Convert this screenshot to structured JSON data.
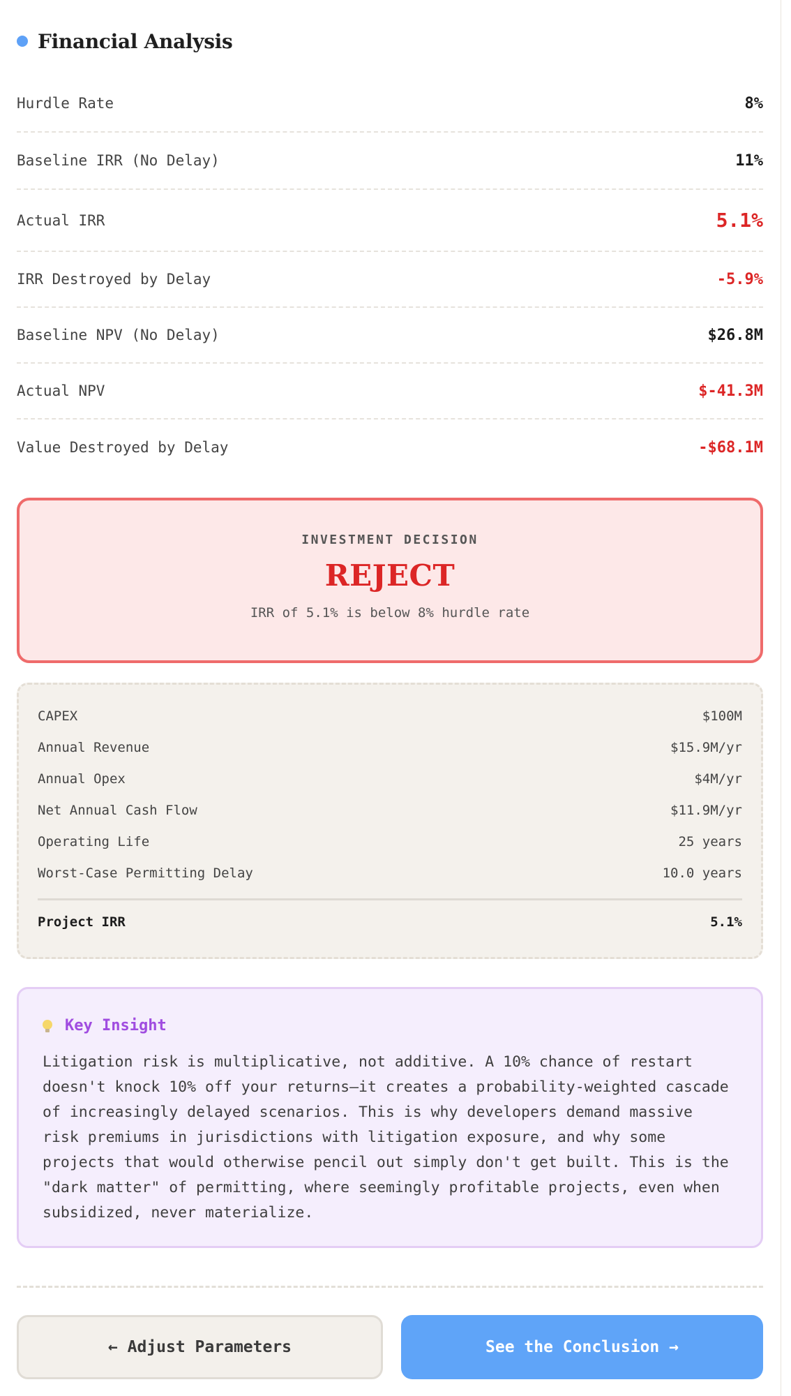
{
  "section": {
    "title": "Financial Analysis",
    "accent": "#5ea1f7"
  },
  "metrics": [
    {
      "label": "Hurdle Rate",
      "value": "8%",
      "tone": "normal"
    },
    {
      "label": "Baseline IRR (No Delay)",
      "value": "11%",
      "tone": "normal"
    },
    {
      "label": "Actual IRR",
      "value": "5.1%",
      "tone": "negative-large"
    },
    {
      "label": "IRR Destroyed by Delay",
      "value": "-5.9%",
      "tone": "negative"
    },
    {
      "label": "Baseline NPV (No Delay)",
      "value": "$26.8M",
      "tone": "normal"
    },
    {
      "label": "Actual NPV",
      "value": "$-41.3M",
      "tone": "negative"
    },
    {
      "label": "Value Destroyed by Delay",
      "value": "-$68.1M",
      "tone": "negative"
    }
  ],
  "decision": {
    "kicker": "INVESTMENT DECISION",
    "verdict": "REJECT",
    "explanation": "IRR of 5.1% is below 8% hurdle rate",
    "color": "#dc2626"
  },
  "parameters": [
    {
      "label": "CAPEX",
      "value": "$100M"
    },
    {
      "label": "Annual Revenue",
      "value": "$15.9M/yr"
    },
    {
      "label": "Annual Opex",
      "value": "$4M/yr"
    },
    {
      "label": "Net Annual Cash Flow",
      "value": "$11.9M/yr"
    },
    {
      "label": "Operating Life",
      "value": "25 years"
    },
    {
      "label": "Worst-Case Permitting Delay",
      "value": "10.0 years"
    }
  ],
  "parameters_total": {
    "label": "Project IRR",
    "value": "5.1%"
  },
  "insight": {
    "icon": "lightbulb-icon",
    "title": "Key Insight",
    "body": "Litigation risk is multiplicative, not additive. A 10% chance of restart doesn't knock 10% off your returns—it creates a probability-weighted cascade of increasingly delayed scenarios. This is why developers demand massive risk premiums in jurisdictions with litigation exposure, and why some projects that would otherwise pencil out simply don't get built. This is the \"dark matter\" of permitting, where seemingly profitable projects, even when subsidized, never materialize.",
    "accent": "#a04ce0"
  },
  "buttons": {
    "back_label": "← Adjust Parameters",
    "next_label": "See the Conclusion →",
    "primary_color": "#5fa4f8"
  }
}
